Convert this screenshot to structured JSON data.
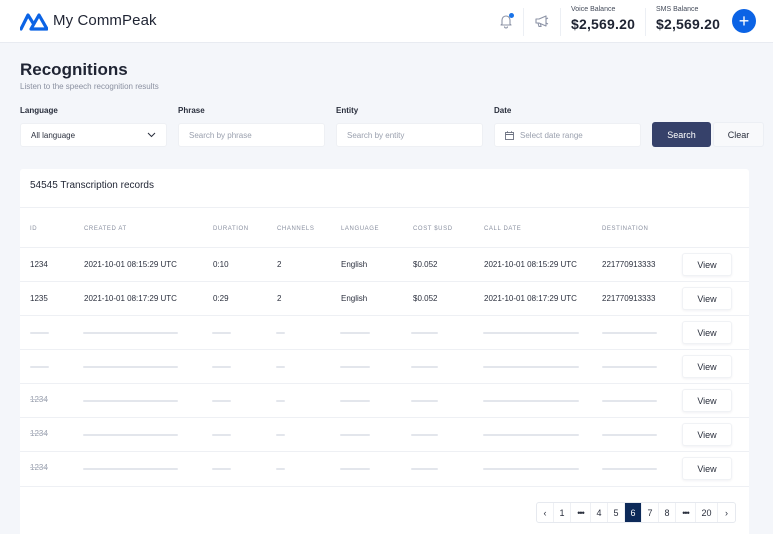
{
  "header": {
    "brand": "My CommPeak",
    "accent_color": "#0b63e5",
    "icons": [
      "logo-icon",
      "bell-icon",
      "megaphone-icon",
      "plus-icon"
    ],
    "has_notification": true,
    "voice_balance": {
      "label": "Voice Balance",
      "value": "$2,569.20"
    },
    "sms_balance": {
      "label": "SMS Balance",
      "value": "$2,569.20"
    },
    "add_button": "+"
  },
  "page": {
    "title": "Recognitions",
    "subtitle": "Listen to the speech recognition results"
  },
  "filters": {
    "language": {
      "label": "Language",
      "value": "All language"
    },
    "phrase": {
      "label": "Phrase",
      "placeholder": "Search by phrase",
      "value": ""
    },
    "entity": {
      "label": "Entity",
      "placeholder": "Search by entity",
      "value": ""
    },
    "date": {
      "label": "Date",
      "placeholder": "Select date range"
    },
    "search_button": "Search",
    "clear_button": "Clear",
    "search_button_color": "#36416a"
  },
  "table": {
    "title": "54545 Transcription records",
    "columns": [
      "ID",
      "CREATED AT",
      "DURATION",
      "CHANNELS",
      "LANGUAGE",
      "COST $USD",
      "CALL DATE",
      "DESTINATION"
    ],
    "rows": [
      {
        "id": "1234",
        "created_at": "2021-10-01 08:15:29 UTC",
        "duration": "0:10",
        "channels": "2",
        "language": "English",
        "cost": "$0.052",
        "call_date": "2021-10-01 08:15:29 UTC",
        "destination": "221770913333",
        "action": "View"
      },
      {
        "id": "1235",
        "created_at": "2021-10-01 08:17:29 UTC",
        "duration": "0:29",
        "channels": "2",
        "language": "English",
        "cost": "$0.052",
        "call_date": "2021-10-01 08:17:29 UTC",
        "destination": "221770913333",
        "action": "View"
      }
    ],
    "skeleton_rows": [
      {
        "id": "",
        "action": "View"
      },
      {
        "id": "",
        "action": "View"
      },
      {
        "id": "1234",
        "action": "View"
      },
      {
        "id": "1234",
        "action": "View"
      },
      {
        "id": "1234",
        "action": "View"
      }
    ]
  },
  "pagination": {
    "prev": "‹",
    "next": "›",
    "items": [
      "1",
      "•••",
      "4",
      "5",
      "6",
      "7",
      "8",
      "•••",
      "20"
    ],
    "current": "6",
    "active_color": "#0d2a59"
  }
}
